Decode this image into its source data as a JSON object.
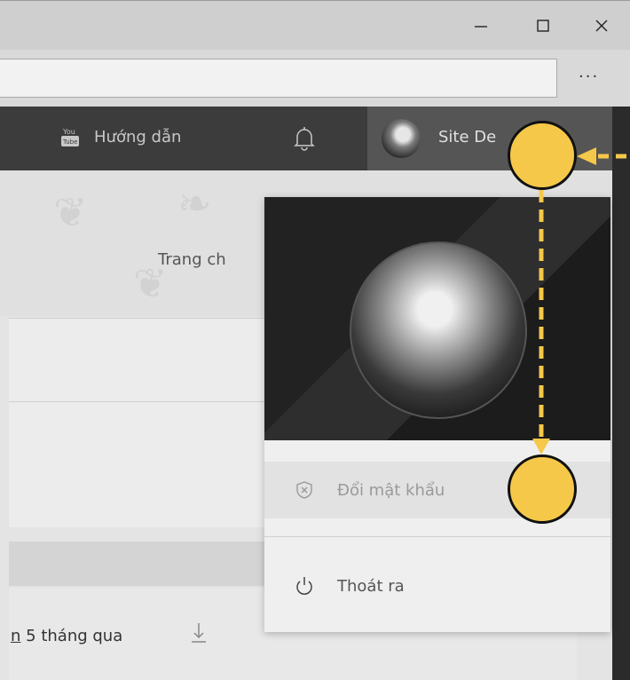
{
  "window": {
    "minimize_icon": "minimize-icon",
    "maximize_icon": "maximize-icon",
    "close_icon": "close-icon",
    "more_label": "···"
  },
  "nav": {
    "guide_label": "Hướng dẫn",
    "guide_icon": "youtube-icon",
    "bell_icon": "bell-icon",
    "user_name": "Site De"
  },
  "page": {
    "breadcrumb": "Trang ch",
    "months_text": "n 5 tháng qua",
    "download_icon": "download-icon"
  },
  "dropdown": {
    "change_password_label": "Đổi mật khẩu",
    "change_password_icon": "shield-x-icon",
    "logout_label": "Thoát ra",
    "logout_icon": "power-icon"
  },
  "colors": {
    "highlight": "#f5c84a",
    "arrow": "#f5c84a"
  }
}
